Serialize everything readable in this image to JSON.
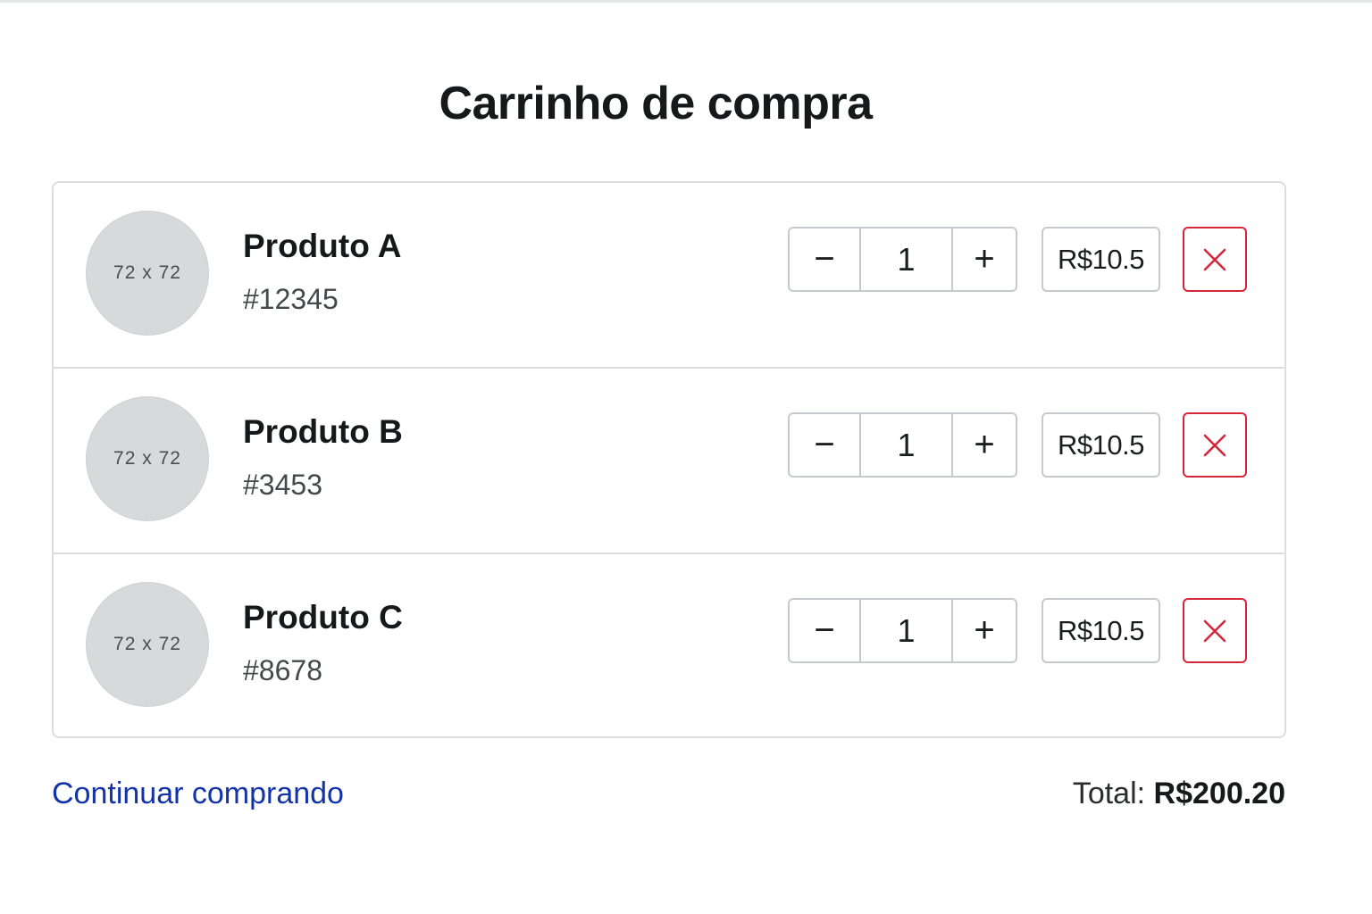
{
  "page": {
    "title": "Carrinho de compra"
  },
  "cart": {
    "items": [
      {
        "thumb_label": "72 x 72",
        "name": "Produto A",
        "code": "#12345",
        "quantity": "1",
        "price": "R$10.5"
      },
      {
        "thumb_label": "72 x 72",
        "name": "Produto B",
        "code": "#3453",
        "quantity": "1",
        "price": "R$10.5"
      },
      {
        "thumb_label": "72 x 72",
        "name": "Produto C",
        "code": "#8678",
        "quantity": "1",
        "price": "R$10.5"
      }
    ],
    "decrement_symbol": "−",
    "increment_symbol": "+"
  },
  "footer": {
    "continue_label": "Continuar comprando",
    "total_label": "Total:",
    "total_value": "R$200.20"
  },
  "colors": {
    "link": "#1334a8",
    "danger": "#d4283a",
    "border": "#dcdde0",
    "thumb": "#d8d9da"
  },
  "icons": {
    "remove": "close-icon",
    "decrement": "minus-icon",
    "increment": "plus-icon"
  }
}
